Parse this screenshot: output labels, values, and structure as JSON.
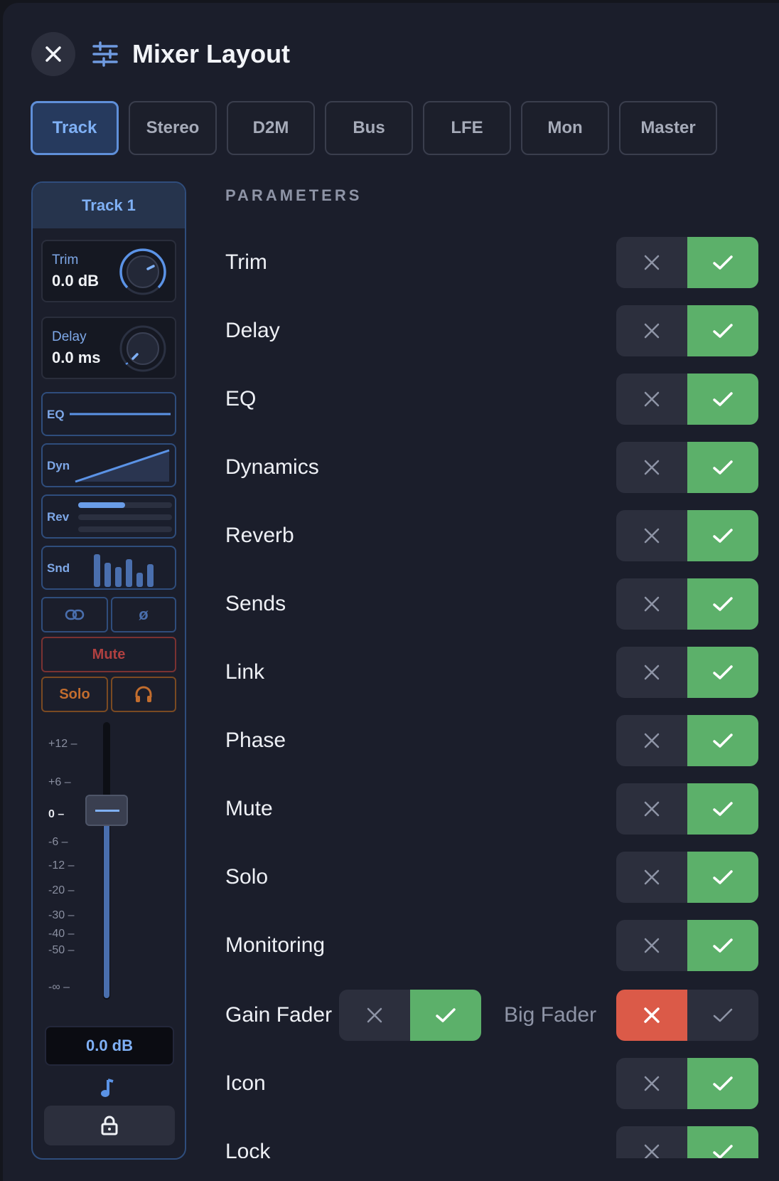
{
  "header": {
    "title": "Mixer Layout",
    "close_icon": "close-icon",
    "title_icon": "sliders-icon"
  },
  "tabs": [
    {
      "label": "Track",
      "active": true
    },
    {
      "label": "Stereo",
      "active": false
    },
    {
      "label": "D2M",
      "active": false
    },
    {
      "label": "Bus",
      "active": false
    },
    {
      "label": "LFE",
      "active": false
    },
    {
      "label": "Mon",
      "active": false
    },
    {
      "label": "Master",
      "active": false
    }
  ],
  "strip": {
    "name": "Track 1",
    "trim": {
      "label": "Trim",
      "value": "0.0 dB"
    },
    "delay": {
      "label": "Delay",
      "value": "0.0 ms"
    },
    "eq_label": "EQ",
    "dyn_label": "Dyn",
    "rev_label": "Rev",
    "snd_label": "Snd",
    "link_icon": "link-icon",
    "phase_symbol": "ø",
    "mute_label": "Mute",
    "solo_label": "Solo",
    "headphones_icon": "headphones-icon",
    "scale": [
      "+12",
      "+6",
      "0",
      "-6",
      "-12",
      "-20",
      "-30",
      "-40",
      "-50",
      "-∞"
    ],
    "fader_value": "0.0 dB",
    "note_icon": "music-note-icon",
    "lock_icon": "lock-icon"
  },
  "parameters": {
    "heading": "PARAMETERS",
    "rows": [
      {
        "label": "Trim",
        "enabled": true
      },
      {
        "label": "Delay",
        "enabled": true
      },
      {
        "label": "EQ",
        "enabled": true
      },
      {
        "label": "Dynamics",
        "enabled": true
      },
      {
        "label": "Reverb",
        "enabled": true
      },
      {
        "label": "Sends",
        "enabled": true
      },
      {
        "label": "Link",
        "enabled": true
      },
      {
        "label": "Phase",
        "enabled": true
      },
      {
        "label": "Mute",
        "enabled": true
      },
      {
        "label": "Solo",
        "enabled": true
      },
      {
        "label": "Monitoring",
        "enabled": true
      }
    ],
    "gain_fader": {
      "label": "Gain Fader",
      "enabled": true
    },
    "big_fader": {
      "label": "Big Fader",
      "enabled": false
    },
    "rows_after": [
      {
        "label": "Icon",
        "enabled": true
      },
      {
        "label": "Lock",
        "enabled": true
      }
    ]
  },
  "colors": {
    "accent": "#5f8fd9",
    "on": "#5cb06a",
    "off_red": "#db5a48",
    "background": "#1b1e2b"
  }
}
